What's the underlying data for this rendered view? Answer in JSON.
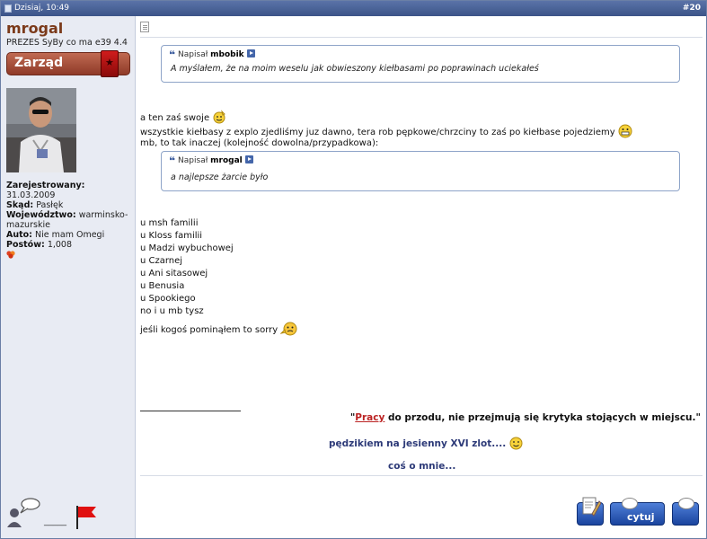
{
  "header": {
    "date": "Dzisiaj, 10:49",
    "post_number": "#20"
  },
  "user": {
    "name": "mrogal",
    "title": "PREZES SyBy co ma e39 4.4",
    "rank": "Zarząd",
    "info": [
      {
        "label": "Zarejestrowany:",
        "value": "31.03.2009"
      },
      {
        "label": "Skąd:",
        "value": "Pasłęk"
      },
      {
        "label": "Województwo:",
        "value": "warminsko-mazurskie"
      },
      {
        "label": "Auto:",
        "value": "Nie mam Omegi"
      },
      {
        "label": "Postów:",
        "value": "1,008"
      }
    ],
    "status_separator": "_____"
  },
  "quotes": [
    {
      "prefix": "Napisał",
      "author": "mbobik",
      "text": "A myślałem, że na moim weselu jak obwieszony kiełbasami po poprawinach uciekałeś"
    },
    {
      "prefix": "Napisał",
      "author": "mrogal",
      "text": "a najlepsze żarcie było"
    }
  ],
  "message": {
    "line1": "a ten zaś swoje",
    "line2": "wszystkie kiełbasy z explo zjedliśmy juz dawno, tera rob pępkowe/chrzciny to zaś po kiełbase pojedziemy",
    "line3": "mb, to tak inaczej (kolejność dowolna/przypadkowa):",
    "list": [
      "u msh familii",
      "u Kloss familii",
      "u Madzi wybuchowej",
      "u Czarnej",
      "u Ani sitasowej",
      "u Benusia",
      "u Spookiego",
      "no i u mb tysz"
    ],
    "closing": "jeśli kogoś pominąłem to sorry"
  },
  "signature": {
    "line1_open": "\"",
    "line1_link": "Pracy",
    "line1_rest": " do przodu, nie przejmują się krytyka stojących w miejscu.\"",
    "line2": "pędzikiem na jesienny XVI zlot....",
    "line3": "coś o mnie..."
  },
  "buttons": {
    "quote_label": "cytuj"
  }
}
